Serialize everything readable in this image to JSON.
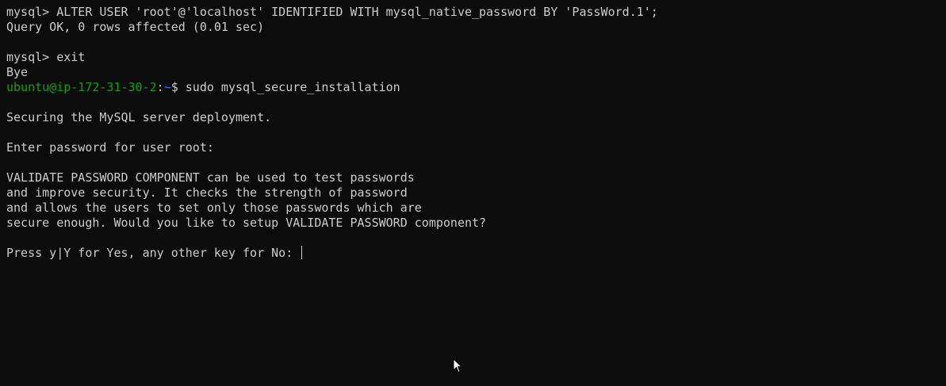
{
  "terminal": {
    "lines": [
      "mysql> ALTER USER 'root'@'localhost' IDENTIFIED WITH mysql_native_password BY 'PassWord.1';",
      "Query OK, 0 rows affected (0.01 sec)",
      "",
      "mysql> exit",
      "Bye",
      "",
      "",
      "Securing the MySQL server deployment.",
      "",
      "Enter password for user root:",
      "",
      "VALIDATE PASSWORD COMPONENT can be used to test passwords",
      "and improve security. It checks the strength of password",
      "and allows the users to set only those passwords which are",
      "secure enough. Would you like to setup VALIDATE PASSWORD component?",
      "",
      "Press y|Y for Yes, any other key for No: "
    ],
    "shell_prompt": {
      "user_host": "ubuntu@ip-172-31-30-2",
      "separator": ":",
      "path": "~",
      "symbol": "$ ",
      "command": "sudo mysql_secure_installation"
    },
    "colors": {
      "background": "#0c0c0c",
      "foreground": "#cccccc",
      "prompt_user": "#13a10e",
      "prompt_path": "#3b78ff"
    },
    "icons": {
      "pointer": "mouse-pointer-icon"
    }
  }
}
